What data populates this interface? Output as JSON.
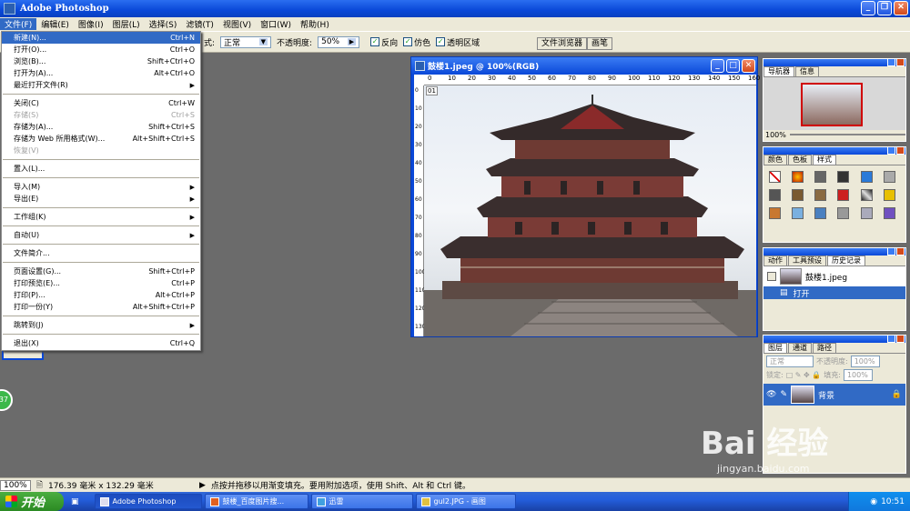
{
  "app": {
    "title": "Adobe Photoshop"
  },
  "menubar": [
    "文件(F)",
    "编辑(E)",
    "图像(I)",
    "图层(L)",
    "选择(S)",
    "滤镜(T)",
    "视图(V)",
    "窗口(W)",
    "帮助(H)"
  ],
  "options": {
    "mode_label": "式:",
    "mode_value": "正常",
    "opacity_label": "不透明度:",
    "opacity_value": "50%",
    "reverse_label": "反向",
    "dither_label": "仿色",
    "transparency_label": "透明区域",
    "file_browser_tab": "文件浏览器",
    "brushes_tab": "画笔"
  },
  "file_menu": {
    "groups": [
      [
        {
          "label": "新建(N)...",
          "shortcut": "Ctrl+N",
          "highlighted": true
        },
        {
          "label": "打开(O)...",
          "shortcut": "Ctrl+O"
        },
        {
          "label": "浏览(B)...",
          "shortcut": "Shift+Ctrl+O"
        },
        {
          "label": "打开为(A)...",
          "shortcut": "Alt+Ctrl+O"
        },
        {
          "label": "最近打开文件(R)",
          "shortcut": "",
          "submenu": true
        }
      ],
      [
        {
          "label": "关闭(C)",
          "shortcut": "Ctrl+W"
        },
        {
          "label": "存储(S)",
          "shortcut": "Ctrl+S",
          "disabled": true
        },
        {
          "label": "存储为(A)...",
          "shortcut": "Shift+Ctrl+S"
        },
        {
          "label": "存储为 Web 所用格式(W)...",
          "shortcut": "Alt+Shift+Ctrl+S"
        },
        {
          "label": "恢复(V)",
          "shortcut": "",
          "disabled": true
        }
      ],
      [
        {
          "label": "置入(L)...",
          "shortcut": ""
        }
      ],
      [
        {
          "label": "导入(M)",
          "shortcut": "",
          "submenu": true
        },
        {
          "label": "导出(E)",
          "shortcut": "",
          "submenu": true
        }
      ],
      [
        {
          "label": "工作组(K)",
          "shortcut": "",
          "submenu": true
        }
      ],
      [
        {
          "label": "自动(U)",
          "shortcut": "",
          "submenu": true
        }
      ],
      [
        {
          "label": "文件简介...",
          "shortcut": ""
        }
      ],
      [
        {
          "label": "页面设置(G)...",
          "shortcut": "Shift+Ctrl+P"
        },
        {
          "label": "打印预览(E)...",
          "shortcut": "Ctrl+P"
        },
        {
          "label": "打印(P)...",
          "shortcut": "Alt+Ctrl+P"
        },
        {
          "label": "打印一份(Y)",
          "shortcut": "Alt+Shift+Ctrl+P"
        }
      ],
      [
        {
          "label": "跳转到(J)",
          "shortcut": "",
          "submenu": true
        }
      ],
      [
        {
          "label": "退出(X)",
          "shortcut": "Ctrl+Q"
        }
      ]
    ]
  },
  "document": {
    "title": "鼓楼1.jpeg @ 100%(RGB)",
    "ruler_ticks": [
      "0",
      "10",
      "20",
      "30",
      "40",
      "50",
      "60",
      "70",
      "80",
      "90",
      "100",
      "110",
      "120",
      "130",
      "140",
      "150",
      "160"
    ],
    "ruler_left_ticks": [
      "0",
      "10",
      "20",
      "30",
      "40",
      "50",
      "60",
      "70",
      "80",
      "90",
      "100",
      "110",
      "120",
      "130"
    ],
    "corner_label": "01"
  },
  "navigator": {
    "tabs": [
      "导航器",
      "信息"
    ],
    "zoom": "100%"
  },
  "color_panel": {
    "tabs": [
      "颜色",
      "色板",
      "样式"
    ]
  },
  "history_panel": {
    "tabs": [
      "动作",
      "工具预设",
      "历史记录"
    ],
    "snapshot": "鼓楼1.jpeg",
    "state": "打开"
  },
  "layers_panel": {
    "tabs": [
      "图层",
      "通道",
      "路径"
    ],
    "blend_mode": "正常",
    "opacity_label": "不透明度:",
    "opacity_value": "100%",
    "lock_label": "锁定:",
    "fill_label": "填充:",
    "fill_value": "100%",
    "layer_name": "背景"
  },
  "status": {
    "zoom": "100%",
    "size": "176.39 毫米 x 132.29 毫米",
    "hint": "点按并拖移以用渐变填充。要用附加选项，使用 Shift、Alt 和 Ctrl 键。"
  },
  "badge": {
    "value": "37"
  },
  "taskbar": {
    "start": "开始",
    "tasks": [
      {
        "label": "Adobe Photoshop",
        "active": true
      },
      {
        "label": "鼓楼_百度图片搜...",
        "active": false
      },
      {
        "label": "迅雷",
        "active": false
      },
      {
        "label": "gul2.JPG - 画图",
        "active": false
      }
    ],
    "clock": "10:51"
  },
  "watermark": {
    "brand": "Bai 经验",
    "url": "jingyan.baidu.com"
  }
}
